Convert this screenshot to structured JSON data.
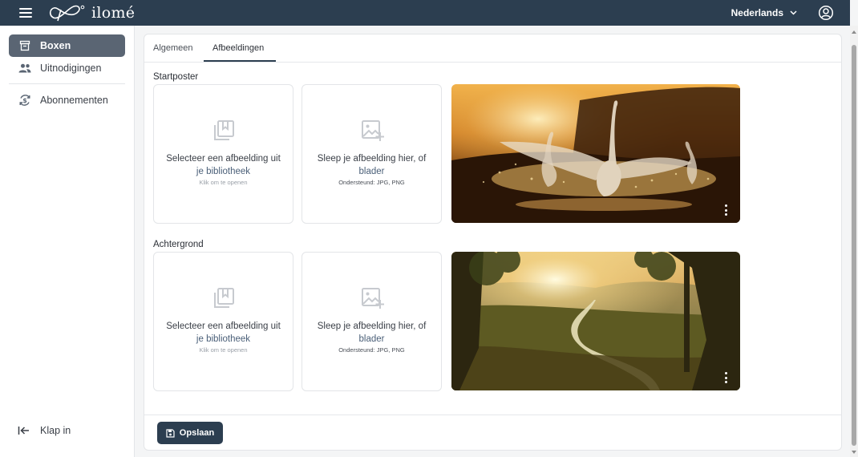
{
  "app": {
    "logo_text": "ilomé"
  },
  "header": {
    "language": "Nederlands"
  },
  "sidebar": {
    "items": [
      {
        "label": "Boxen",
        "icon": "archive-icon",
        "active": true
      },
      {
        "label": "Uitnodigingen",
        "icon": "people-icon",
        "active": false
      },
      {
        "label": "Abonnementen",
        "icon": "subscription-icon",
        "active": false
      }
    ],
    "collapse_label": "Klap in"
  },
  "tabs": [
    {
      "label": "Algemeen",
      "active": false
    },
    {
      "label": "Afbeeldingen",
      "active": true
    }
  ],
  "sections": {
    "startposter": {
      "label": "Startposter",
      "library_tile": {
        "line1": "Selecteer een afbeelding uit",
        "line2": "je bibliotheek",
        "hint": "Klik om te openen"
      },
      "upload_tile": {
        "line1": "Sleep je afbeelding hier, of",
        "link": "blader",
        "hint": "Ondersteund: JPG, PNG"
      }
    },
    "achtergrond": {
      "label": "Achtergrond",
      "library_tile": {
        "line1": "Selecteer een afbeelding uit",
        "line2": "je bibliotheek",
        "hint": "Klik om te openen"
      },
      "upload_tile": {
        "line1": "Sleep je afbeelding hier, of",
        "link": "blader",
        "hint": "Ondersteund: JPG, PNG"
      }
    }
  },
  "footer": {
    "save_label": "Opslaan"
  },
  "colors": {
    "primary": "#2c3e50",
    "active_nav": "#5a6573",
    "link": "#4a5f78"
  }
}
